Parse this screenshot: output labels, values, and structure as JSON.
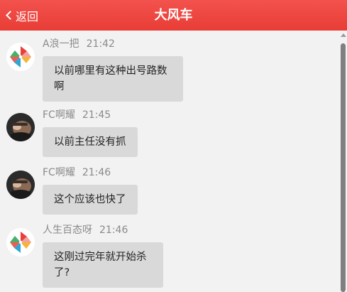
{
  "header": {
    "back_label": "返回",
    "title": "大风车"
  },
  "colors": {
    "header_bg": "#e8403a",
    "bubble_bg": "#d9d9d9",
    "page_bg": "#f2f2f2"
  },
  "messages": [
    {
      "user": "A浪一把",
      "time": "21:42",
      "text": "以前哪里有这种出号路数啊",
      "avatar": "pinwheel"
    },
    {
      "user": "FC啊耀",
      "time": "21:45",
      "text": "以前主任没有抓",
      "avatar": "photo"
    },
    {
      "user": "FC啊耀",
      "time": "21:46",
      "text": "这个应该也快了",
      "avatar": "photo"
    },
    {
      "user": "人生百态呀",
      "time": "21:46",
      "text": "这刚过完年就开始杀了?",
      "avatar": "pinwheel"
    }
  ]
}
